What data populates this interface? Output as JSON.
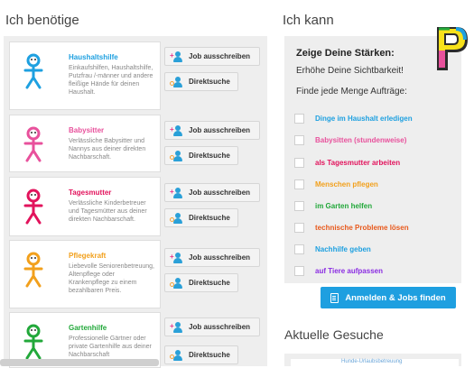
{
  "left": {
    "title": "Ich benötige",
    "categories": [
      {
        "title": "Haushaltshilfe",
        "desc": "Einkaufshilfen, Haushaltshilfe, Putzfrau /-männer und andere fleißige Hände für deinen Haushalt.",
        "color": "#1ea0e0"
      },
      {
        "title": "Babysitter",
        "desc": "Verlässliche Babysitter und Nannys aus deiner direkten Nachbarschaft.",
        "color": "#e8519c"
      },
      {
        "title": "Tagesmutter",
        "desc": "Verlässliche Kinderbetreuer und Tagesmütter aus deiner direkten Nachbarschaft.",
        "color": "#e2135c"
      },
      {
        "title": "Pflegekraft",
        "desc": "Liebevolle Seniorenbetreuung, Altenpflege oder Krankenpflege zu einem bezahlbaren Preis.",
        "color": "#f2a01c"
      },
      {
        "title": "Gartenhilfe",
        "desc": "Professionelle Gärtner oder private Gartenhilfe aus deiner Nachbarschaft",
        "color": "#22a83a"
      }
    ],
    "job_button": "Job ausschreiben",
    "search_button": "Direktsuche"
  },
  "right": {
    "title": "Ich kann",
    "headline": "Zeige Deine Stärken:",
    "line1": "Erhöhe Deine Sichtbarkeit!",
    "line2": "Finde jede Menge Aufträge:",
    "skills": [
      {
        "label": "Dinge im Haushalt erledigen",
        "color": "#1ea0e0"
      },
      {
        "label": "Babysitten (stundenweise)",
        "color": "#e8519c"
      },
      {
        "label": "als Tagesmutter arbeiten",
        "color": "#e2135c"
      },
      {
        "label": "Menschen pflegen",
        "color": "#f2a01c"
      },
      {
        "label": "im Garten helfen",
        "color": "#22a83a"
      },
      {
        "label": "technische Probleme lösen",
        "color": "#e8591c"
      },
      {
        "label": "Nachhilfe geben",
        "color": "#1ea0e0"
      },
      {
        "label": "auf Tiere aufpassen",
        "color": "#8a2be2"
      }
    ],
    "signup_button": "Anmelden & Jobs finden",
    "recent_title": "Aktuelle Gesuche",
    "recent_item": "Hunde-Urlaubsbetreuung"
  },
  "colors": {
    "accent": "#1e9fe0",
    "panel": "#eeeeee"
  }
}
